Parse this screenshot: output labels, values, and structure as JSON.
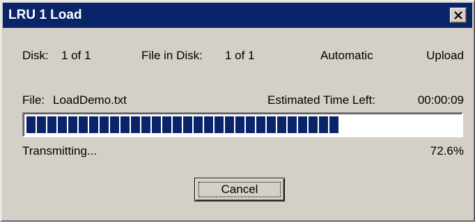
{
  "window": {
    "title": "LRU 1 Load",
    "close_icon": "close-icon"
  },
  "status": {
    "disk_label": "Disk:",
    "disk_value": "1 of 1",
    "file_in_disk_label": "File in Disk:",
    "file_in_disk_value": "1 of 1",
    "mode": "Automatic",
    "direction": "Upload"
  },
  "file": {
    "label": "File:",
    "name": "LoadDemo.txt",
    "time_left_label": "Estimated Time Left:",
    "time_left_value": "00:00:09"
  },
  "progress": {
    "fraction": 0.726,
    "state_text": "Transmitting...",
    "percent_text": "72.6%",
    "color": "#0a246a"
  },
  "buttons": {
    "cancel_label": "Cancel"
  }
}
